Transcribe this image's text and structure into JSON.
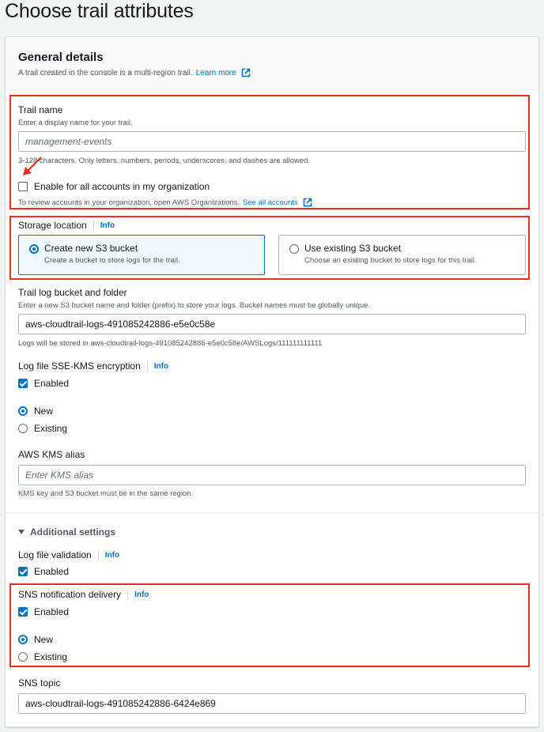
{
  "page": {
    "title": "Choose trail attributes"
  },
  "general_details": {
    "title": "General details",
    "description": "A trail created in the console is a multi-region trail.",
    "learn_more": "Learn more"
  },
  "trail_name": {
    "label": "Trail name",
    "description": "Enter a display name for your trail.",
    "value": "management-events",
    "hint": "3-128 characters. Only letters, numbers, periods, underscores, and dashes are allowed."
  },
  "organization": {
    "checkbox_label": "Enable for all accounts in my organization",
    "checked": false,
    "hint": "To review accounts in your organization, open AWS Organizations.",
    "link": "See all accounts"
  },
  "storage_location": {
    "label": "Storage location",
    "info": "Info",
    "options": [
      {
        "title": "Create new S3 bucket",
        "description": "Create a bucket to store logs for the trail.",
        "selected": true
      },
      {
        "title": "Use existing S3 bucket",
        "description": "Choose an existing bucket to store logs for this trail.",
        "selected": false
      }
    ]
  },
  "bucket": {
    "label": "Trail log bucket and folder",
    "description": "Enter a new S3 bucket name and folder (prefix) to store your logs. Bucket names must be globally unique.",
    "value": "aws-cloudtrail-logs-491085242886-e5e0c58e",
    "hint": "Logs will be stored in aws-cloudtrail-logs-491085242886-e5e0c58e/AWSLogs/111111111111"
  },
  "sse_kms": {
    "label": "Log file SSE-KMS encryption",
    "info": "Info",
    "enabled_label": "Enabled",
    "enabled": true,
    "options": [
      {
        "label": "New",
        "selected": true
      },
      {
        "label": "Existing",
        "selected": false
      }
    ]
  },
  "kms_alias": {
    "label": "AWS KMS alias",
    "placeholder": "Enter KMS alias",
    "hint": "KMS key and S3 bucket must be in the same region."
  },
  "additional_settings": {
    "label": "Additional settings",
    "expanded": true
  },
  "log_validation": {
    "label": "Log file validation",
    "info": "Info",
    "enabled_label": "Enabled",
    "enabled": true
  },
  "sns_delivery": {
    "label": "SNS notification delivery",
    "info": "Info",
    "enabled_label": "Enabled",
    "enabled": true,
    "options": [
      {
        "label": "New",
        "selected": true
      },
      {
        "label": "Existing",
        "selected": false
      }
    ]
  },
  "sns_topic": {
    "label": "SNS topic",
    "value": "aws-cloudtrail-logs-491085242886-6424e869"
  },
  "colors": {
    "accent": "#0073bb",
    "annotation": "#ee2b24",
    "selected_tile_bg": "#f1faff"
  }
}
